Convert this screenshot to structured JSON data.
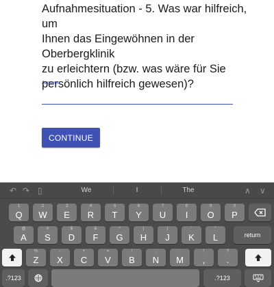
{
  "question": {
    "lines": [
      "Aufnahmesituation - 5. Was war hilfreich, um",
      "Ihnen das Eingewöhnen in der Oberbergklinik",
      "zu erleichtern (bzw. was wäre für Sie",
      "persönlich hilfreich gewesen)?"
    ]
  },
  "answer": {
    "label": "Answer",
    "value": ""
  },
  "continue_label": "CONTINUE",
  "keyboard": {
    "toolbar": {
      "undo_icon": "undo-icon",
      "redo_icon": "redo-icon",
      "paste_icon": "clipboard-icon",
      "up_icon": "chevron-up-icon",
      "down_icon": "chevron-down-icon"
    },
    "suggestions": [
      "We",
      "I",
      "The"
    ],
    "row1": [
      {
        "sub": "1",
        "main": "Q"
      },
      {
        "sub": "2",
        "main": "W"
      },
      {
        "sub": "3",
        "main": "E"
      },
      {
        "sub": "4",
        "main": "R"
      },
      {
        "sub": "5",
        "main": "T"
      },
      {
        "sub": "6",
        "main": "Y"
      },
      {
        "sub": "7",
        "main": "U"
      },
      {
        "sub": "8",
        "main": "I"
      },
      {
        "sub": "9",
        "main": "O"
      },
      {
        "sub": "0",
        "main": "P"
      }
    ],
    "row2": [
      {
        "sub": "@",
        "main": "A"
      },
      {
        "sub": "#",
        "main": "S"
      },
      {
        "sub": "$",
        "main": "D"
      },
      {
        "sub": "&",
        "main": "F"
      },
      {
        "sub": "*",
        "main": "G"
      },
      {
        "sub": "(",
        "main": "H"
      },
      {
        "sub": ")",
        "main": "J"
      },
      {
        "sub": "'",
        "main": "K"
      },
      {
        "sub": "\"",
        "main": "L"
      }
    ],
    "row3": [
      {
        "sub": "%",
        "main": "Z"
      },
      {
        "sub": "-",
        "main": "X"
      },
      {
        "sub": "+",
        "main": "C"
      },
      {
        "sub": "=",
        "main": "V"
      },
      {
        "sub": "/",
        "main": "B"
      },
      {
        "sub": ";",
        "main": "N"
      },
      {
        "sub": ":",
        "main": "M"
      },
      {
        "sub": "!",
        "main": ","
      },
      {
        "sub": "?",
        "main": "."
      }
    ],
    "return_label": "return",
    "num_label": ".?123",
    "backspace_icon": "backspace-icon",
    "shift_icon": "shift-icon",
    "globe_icon": "globe-icon",
    "hide_keyboard_icon": "keyboard-hide-icon"
  }
}
